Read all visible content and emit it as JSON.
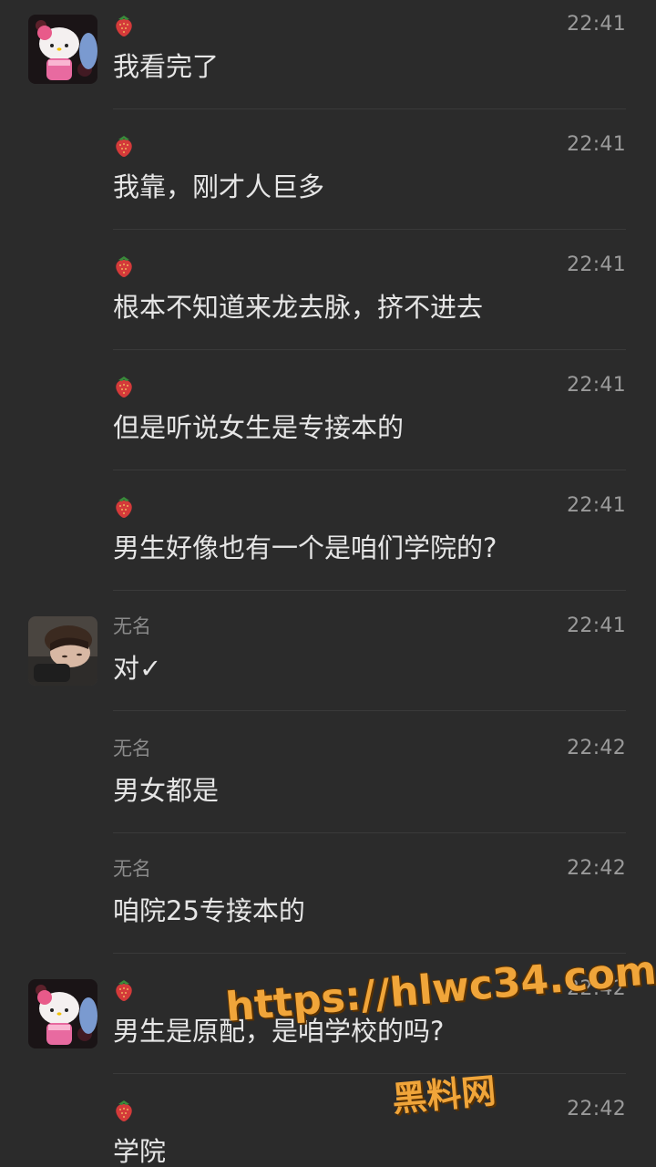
{
  "colors": {
    "background": "#2b2b2b",
    "message_text": "#e6e6e6",
    "meta_text": "#8a8a8a",
    "divider": "#3a3a3a",
    "watermark": "#f0a53a"
  },
  "messages": [
    {
      "sender_icon": "strawberry-icon",
      "sender": "",
      "time": "22:41",
      "text": "我看完了",
      "avatar": "hello-kitty"
    },
    {
      "sender_icon": "strawberry-icon",
      "sender": "",
      "time": "22:41",
      "text": "我靠，刚才人巨多",
      "avatar": ""
    },
    {
      "sender_icon": "strawberry-icon",
      "sender": "",
      "time": "22:41",
      "text": "根本不知道来龙去脉，挤不进去",
      "avatar": ""
    },
    {
      "sender_icon": "strawberry-icon",
      "sender": "",
      "time": "22:41",
      "text": "但是听说女生是专接本的",
      "avatar": ""
    },
    {
      "sender_icon": "strawberry-icon",
      "sender": "",
      "time": "22:41",
      "text": "男生好像也有一个是咱们学院的?",
      "avatar": ""
    },
    {
      "sender_icon": "",
      "sender": "无名",
      "time": "22:41",
      "text": "对✓",
      "avatar": "person-photo"
    },
    {
      "sender_icon": "",
      "sender": "无名",
      "time": "22:42",
      "text": "男女都是",
      "avatar": ""
    },
    {
      "sender_icon": "",
      "sender": "无名",
      "time": "22:42",
      "text": "咱院25专接本的",
      "avatar": ""
    },
    {
      "sender_icon": "strawberry-icon",
      "sender": "",
      "time": "22:42",
      "text": "男生是原配，是咱学校的吗?",
      "avatar": "hello-kitty"
    },
    {
      "sender_icon": "strawberry-icon",
      "sender": "",
      "time": "22:42",
      "text": "学院",
      "avatar": ""
    }
  ],
  "watermark": {
    "url": "https://hlwc34.com",
    "name": "黑料网"
  }
}
